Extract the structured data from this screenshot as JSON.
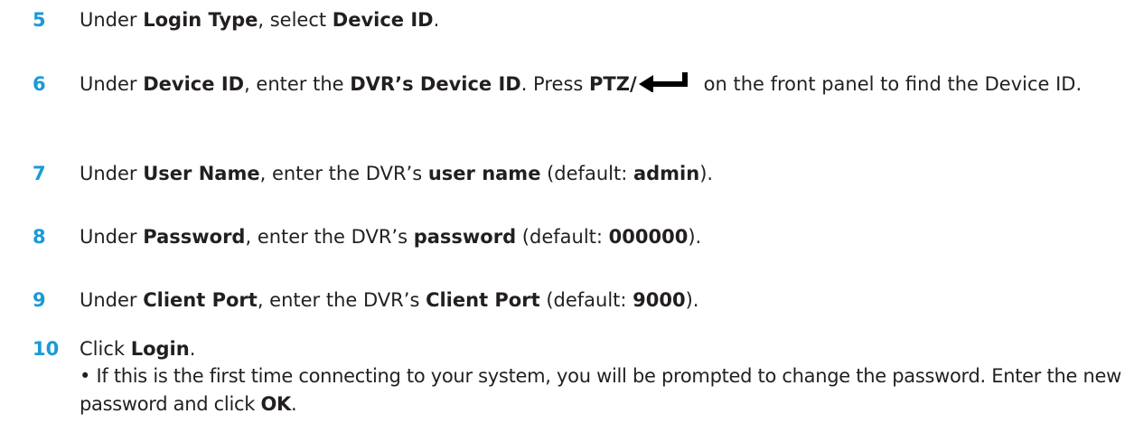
{
  "steps": [
    {
      "number": "5",
      "parts": [
        "Under ",
        "Login Type",
        ", select ",
        "Device ID",
        "."
      ]
    },
    {
      "number": "6",
      "parts": [
        "Under ",
        "Device ID",
        ", enter the ",
        "DVR’s Device ID",
        ". Press ",
        "PTZ/",
        "on the front panel to find the Device ID."
      ],
      "icon": "enter-arrow-icon"
    },
    {
      "number": "7",
      "parts": [
        "Under ",
        "User Name",
        ", enter the DVR’s ",
        "user name",
        " (default: ",
        "admin",
        ")."
      ]
    },
    {
      "number": "8",
      "parts": [
        "Under ",
        "Password",
        ", enter the DVR’s ",
        "password",
        " (default: ",
        "000000",
        ")."
      ]
    },
    {
      "number": "9",
      "parts": [
        "Under ",
        "Client Port",
        ", enter the DVR’s ",
        "Client Port",
        " (default: ",
        "9000",
        ")."
      ]
    },
    {
      "number": "10",
      "parts": [
        "Click ",
        "Login",
        "."
      ],
      "bullets": [
        {
          "parts": [
            "• If this is the first time connecting to your system, you will be prompted to change the password. Enter the new password and click ",
            "OK",
            "."
          ]
        }
      ]
    }
  ],
  "colors": {
    "step_number": "#1a9ad6",
    "text": "#231f20"
  }
}
